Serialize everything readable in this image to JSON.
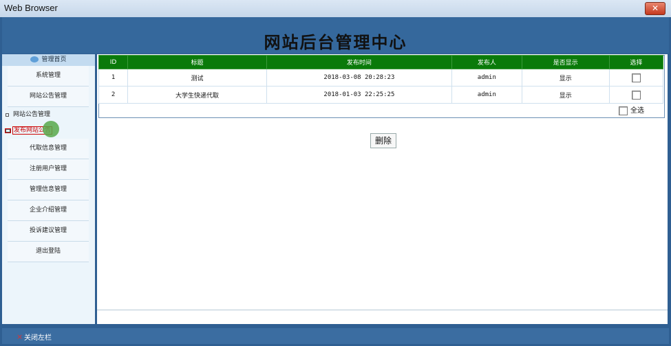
{
  "window": {
    "title": "Web Browser",
    "close_label": "✕"
  },
  "header": {
    "title": "网站后台管理中心"
  },
  "sidebar": {
    "top_label": "管理首页",
    "items": [
      {
        "label": "系统管理"
      },
      {
        "label": "网站公告管理"
      }
    ],
    "sub_items": [
      {
        "label": "网站公告管理"
      },
      {
        "label": "发布网站公告"
      }
    ],
    "items2": [
      {
        "label": "代取信息管理"
      },
      {
        "label": "注册用户管理"
      },
      {
        "label": "管理信息管理"
      },
      {
        "label": "企业介绍管理"
      },
      {
        "label": "投诉建议管理"
      },
      {
        "label": "退出登陆"
      }
    ]
  },
  "table": {
    "columns": [
      "ID",
      "标题",
      "发布时间",
      "发布人",
      "是否显示",
      "选择"
    ],
    "rows": [
      {
        "id": "1",
        "title": "测试",
        "time": "2018-03-08 20:28:23",
        "author": "admin",
        "show": "显示"
      },
      {
        "id": "2",
        "title": "大学生快递代取",
        "time": "2018-01-03 22:25:25",
        "author": "admin",
        "show": "显示"
      }
    ],
    "select_all_label": "全选",
    "delete_label": "删除"
  },
  "footer": {
    "close_left_label": "关闭左栏"
  }
}
